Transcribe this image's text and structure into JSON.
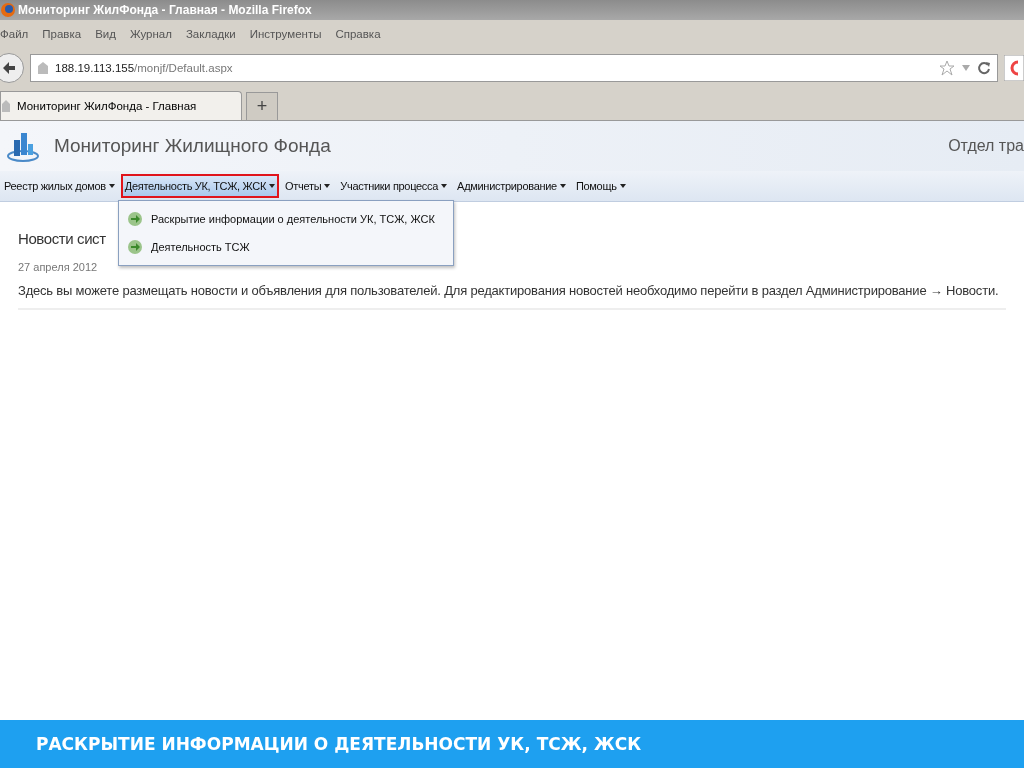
{
  "window": {
    "title": "Мониторинг ЖилФонда - Главная - Mozilla Firefox"
  },
  "browser_menu": [
    "Файл",
    "Правка",
    "Вид",
    "Журнал",
    "Закладки",
    "Инструменты",
    "Справка"
  ],
  "address": {
    "host": "188.19.113.155",
    "path": "/monjf/Default.aspx"
  },
  "tabs": [
    {
      "label": "Мониторинг ЖилФонда - Главная",
      "selected": true
    }
  ],
  "new_tab": "+",
  "site": {
    "title": "Мониторинг Жилищного Фонда",
    "user": "Отдел тра"
  },
  "nav": [
    {
      "label": "Реестр жилых домов",
      "selected": false
    },
    {
      "label": "Деятельность УК, ТСЖ, ЖСК",
      "selected": true
    },
    {
      "label": "Отчеты",
      "selected": false
    },
    {
      "label": "Участники процесса",
      "selected": false
    },
    {
      "label": "Администрирование",
      "selected": false
    },
    {
      "label": "Помощь",
      "selected": false
    }
  ],
  "dropdown": [
    "Раскрытие информации о деятельности УК, ТСЖ, ЖСК",
    "Деятельность ТСЖ"
  ],
  "news": {
    "heading": "Новости сист",
    "date": "27 апреля 2012",
    "text": "Здесь вы можете размещать новости и объявления для пользователей. Для редактирования новостей необходимо перейти в раздел Администрирование → Новости."
  },
  "caption": "РАСКРЫТИЕ ИНФОРМАЦИИ О ДЕЯТЕЛЬНОСТИ УК, ТСЖ, ЖСК"
}
